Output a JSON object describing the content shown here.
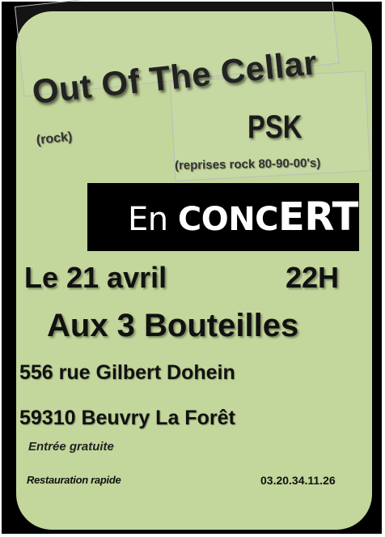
{
  "poster": {
    "band1": "Out Of The Cellar",
    "genre1": "(rock)",
    "band2": "PSK",
    "genre2": "(reprises rock 80-90-00's)",
    "banner_en": "En ",
    "banner_conc": "CONC",
    "banner_ert": "ERT",
    "date": "Le 21 avril",
    "time": "22H",
    "venue": "Aux 3 Bouteilles",
    "street": "556 rue Gilbert Dohein",
    "city": "59310 Beuvry La Forêt",
    "entry": "Entrée gratuite",
    "food": "Restauration rapide",
    "phone": "03.20.34.11.26"
  },
  "colors": {
    "panel": "#c3d69b",
    "frame": "#000000",
    "banner": "#000000",
    "banner_text": "#ffffff"
  }
}
